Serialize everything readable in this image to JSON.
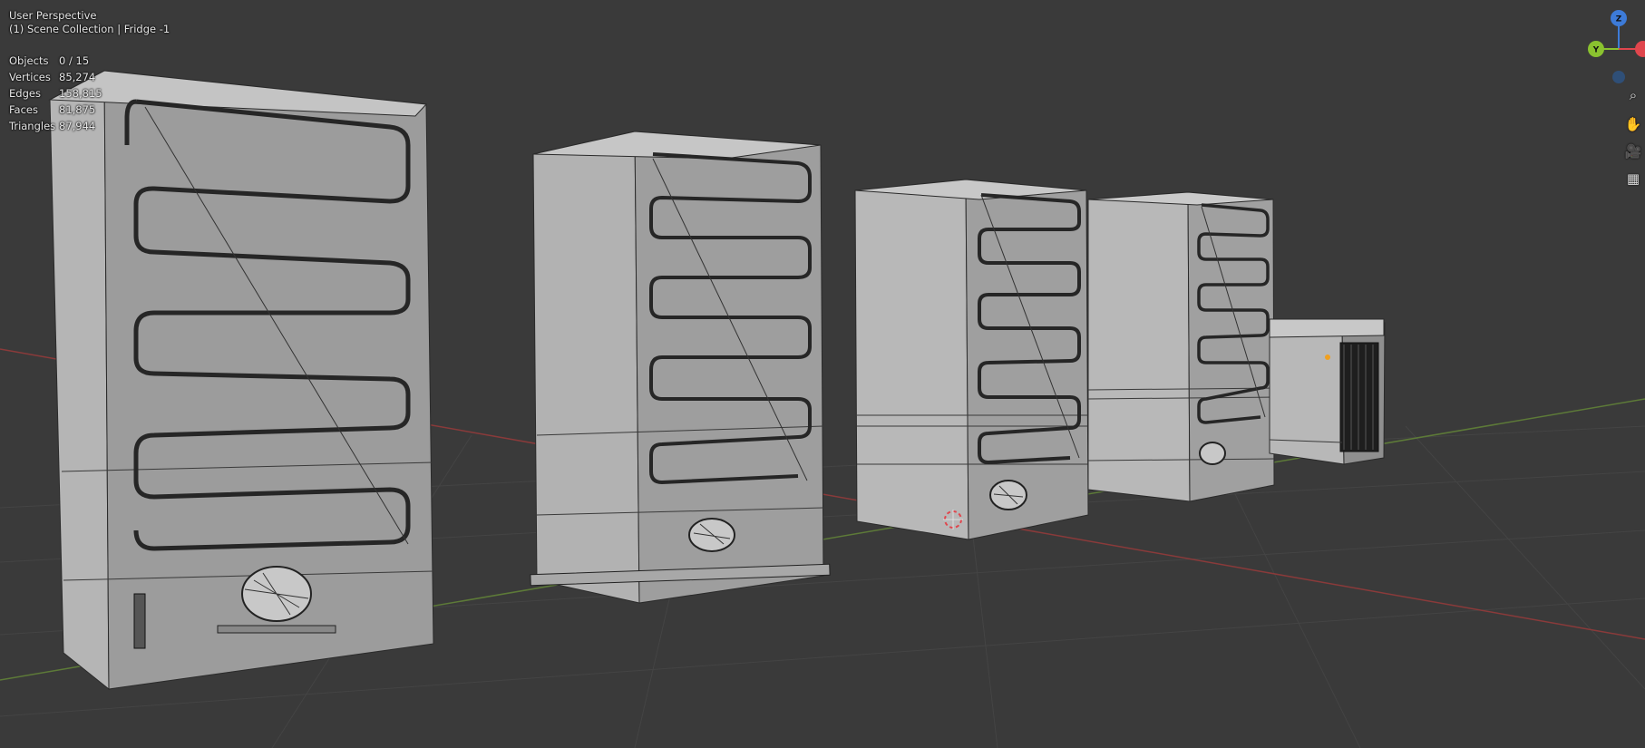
{
  "viewport": {
    "perspective_label": "User Perspective",
    "collection_label": "(1) Scene Collection | Fridge -1"
  },
  "stats": [
    {
      "label": "Objects",
      "value": "0 / 15"
    },
    {
      "label": "Vertices",
      "value": "85,274"
    },
    {
      "label": "Edges",
      "value": "158,815"
    },
    {
      "label": "Faces",
      "value": "81,875"
    },
    {
      "label": "Triangles",
      "value": "87,944"
    }
  ],
  "gizmo": {
    "z_label": "Z",
    "y_label": "Y",
    "colors": {
      "x": "#e0464d",
      "y": "#8ac22f",
      "z": "#3d7bd8",
      "neg": "#2f4f77"
    }
  },
  "navigation_tools": [
    {
      "icon": "zoom-icon",
      "glyph": "⌕"
    },
    {
      "icon": "hand-pan-icon",
      "glyph": "✋"
    },
    {
      "icon": "camera-icon",
      "glyph": "🎥"
    },
    {
      "icon": "grid-icon",
      "glyph": "▦"
    }
  ],
  "colors": {
    "background": "#3a3a3a",
    "grid": "#444444",
    "x_axis": "#8a3a3a",
    "y_axis": "#5d7a38",
    "fridge_face": "#9e9e9e",
    "fridge_side": "#b8b8b8",
    "coil": "#262626"
  }
}
